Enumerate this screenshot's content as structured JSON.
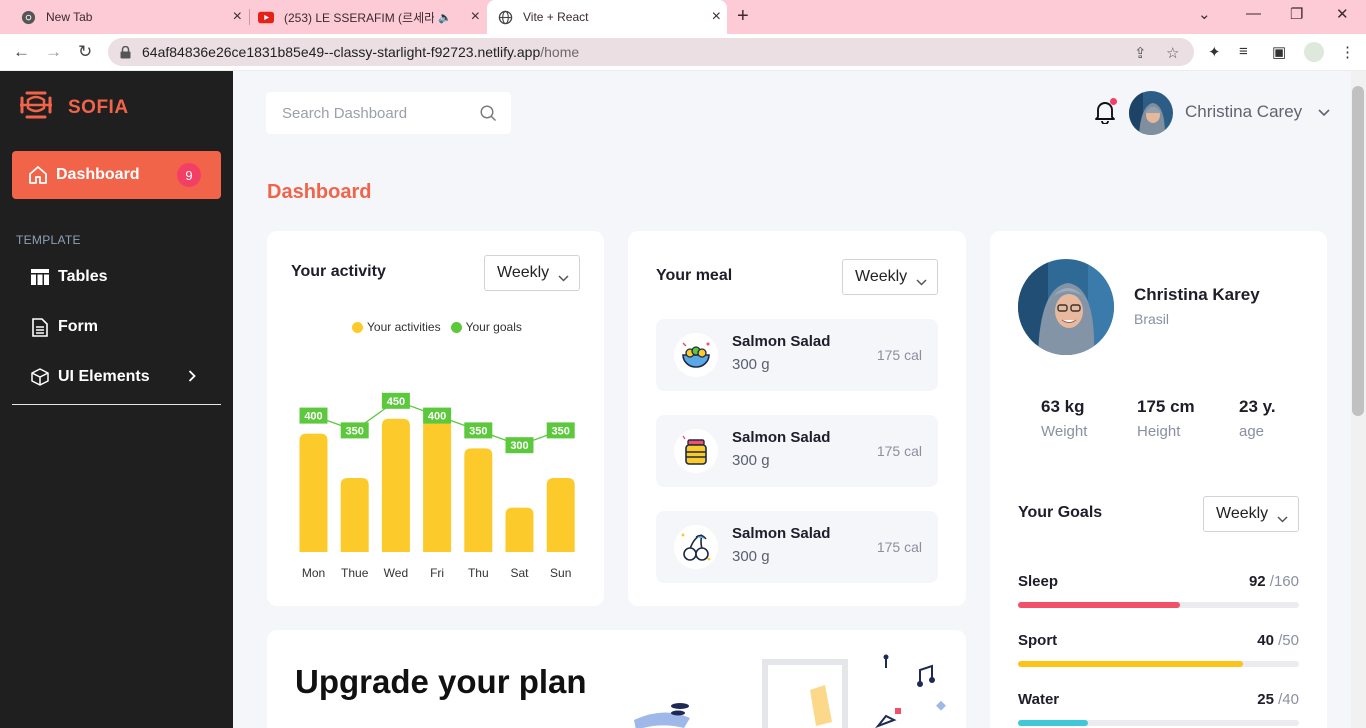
{
  "browser": {
    "tabs": [
      {
        "title": "New Tab"
      },
      {
        "title": "(253) LE SSERAFIM (르세라핌"
      },
      {
        "title": "Vite + React"
      }
    ],
    "url_host": "64af84836e26ce1831b85e49--classy-starlight-f92723.netlify.app",
    "url_path": "/home"
  },
  "sidebar": {
    "brand": "SOFIA",
    "active_item": {
      "label": "Dashboard",
      "badge": "9"
    },
    "section_label": "TEMPLATE",
    "items": [
      {
        "label": "Tables",
        "icon": "table-icon"
      },
      {
        "label": "Form",
        "icon": "document-icon"
      },
      {
        "label": "UI Elements",
        "icon": "cube-icon"
      }
    ]
  },
  "header": {
    "search_placeholder": "Search Dashboard",
    "user_name": "Christina Carey"
  },
  "page_title": "Dashboard",
  "activity": {
    "title": "Your activity",
    "period": "Weekly",
    "legend": [
      "Your activities",
      "Your goals"
    ]
  },
  "chart_data": {
    "type": "bar",
    "categories": [
      "Mon",
      "Thue",
      "Wed",
      "Fri",
      "Thu",
      "Sat",
      "Sun"
    ],
    "series": [
      {
        "name": "Your activities",
        "values": [
          400,
          250,
          450,
          450,
          350,
          150,
          250
        ]
      },
      {
        "name": "Your goals",
        "values": [
          400,
          350,
          450,
          400,
          350,
          300,
          350
        ]
      }
    ],
    "colors": {
      "bars": "#fccb2b",
      "line": "#5cc83c"
    },
    "ylim": [
      0,
      500
    ]
  },
  "meal": {
    "title": "Your meal",
    "period": "Weekly",
    "items": [
      {
        "name": "Salmon Salad",
        "weight": "300 g",
        "cal": "175 cal"
      },
      {
        "name": "Salmon Salad",
        "weight": "300 g",
        "cal": "175 cal"
      },
      {
        "name": "Salmon Salad",
        "weight": "300 g",
        "cal": "175 cal"
      }
    ]
  },
  "profile": {
    "name": "Christina Karey",
    "country": "Brasil",
    "stats": [
      {
        "value": "63 kg",
        "label": "Weight"
      },
      {
        "value": "175 cm",
        "label": "Height"
      },
      {
        "value": "23 y.",
        "label": "age"
      }
    ]
  },
  "goals": {
    "title": "Your Goals",
    "period": "Weekly",
    "items": [
      {
        "name": "Sleep",
        "value": "92",
        "total": "/160",
        "fraction": 0.575,
        "color": "#f25069"
      },
      {
        "name": "Sport",
        "value": "40",
        "total": "/50",
        "fraction": 0.8,
        "color": "#fcc419"
      },
      {
        "name": "Water",
        "value": "25",
        "total": "/40",
        "fraction": 0.25,
        "color": "#3fc8d8"
      }
    ]
  },
  "upgrade": {
    "title": "Upgrade your plan"
  },
  "colors": {
    "accent": "#f2644a",
    "sidebar": "#1f1f1f",
    "badge": "#f43f64"
  }
}
